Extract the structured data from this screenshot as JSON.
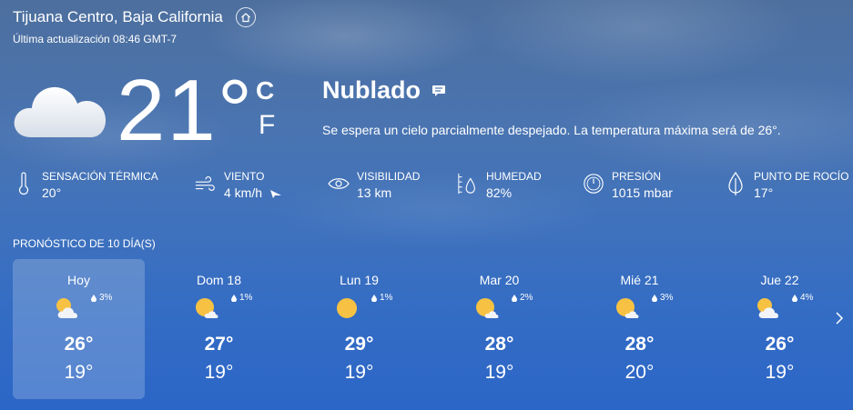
{
  "header": {
    "location": "Tijuana Centro, Baja California",
    "updated": "Última actualización 08:46 GMT-7"
  },
  "current": {
    "temp": "21°",
    "unit_c": "C",
    "unit_f": "F",
    "condition": "Nublado",
    "description": "Se espera un cielo parcialmente despejado. La temperatura máxima será de 26°.",
    "icon": "cloud-icon"
  },
  "stats": [
    {
      "label": "SENSACIÓN TÉRMICA",
      "value": "20°",
      "icon": "thermometer-icon"
    },
    {
      "label": "VIENTO",
      "value": "4 km/h",
      "icon": "wind-icon"
    },
    {
      "label": "VISIBILIDAD",
      "value": "13 km",
      "icon": "eye-icon"
    },
    {
      "label": "HUMEDAD",
      "value": "82%",
      "icon": "humidity-icon"
    },
    {
      "label": "PRESIÓN",
      "value": "1015 mbar",
      "icon": "gauge-icon"
    },
    {
      "label": "PUNTO DE ROCÍO",
      "value": "17°",
      "icon": "dew-icon"
    }
  ],
  "forecast": {
    "title": "PRONÓSTICO DE 10 DÍA(S)",
    "days": [
      {
        "day": "Hoy",
        "precip": "3%",
        "hi": "26°",
        "lo": "19°",
        "icon": "partly-cloudy-icon"
      },
      {
        "day": "Dom 18",
        "precip": "1%",
        "hi": "27°",
        "lo": "19°",
        "icon": "mostly-sunny-icon"
      },
      {
        "day": "Lun 19",
        "precip": "1%",
        "hi": "29°",
        "lo": "19°",
        "icon": "sunny-icon"
      },
      {
        "day": "Mar 20",
        "precip": "2%",
        "hi": "28°",
        "lo": "19°",
        "icon": "mostly-sunny-icon"
      },
      {
        "day": "Mié 21",
        "precip": "3%",
        "hi": "28°",
        "lo": "20°",
        "icon": "mostly-sunny-icon"
      },
      {
        "day": "Jue 22",
        "precip": "4%",
        "hi": "26°",
        "lo": "19°",
        "icon": "partly-cloudy-icon"
      }
    ]
  }
}
